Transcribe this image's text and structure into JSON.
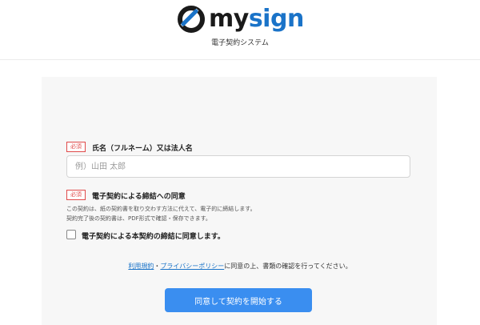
{
  "header": {
    "brand_my": "my",
    "brand_sign": "sign",
    "subtitle": "電子契約システム"
  },
  "form": {
    "required_badge": "必須",
    "name_label": "氏名（フルネーム）又は法人名",
    "name_placeholder": "例）山田 太郎",
    "name_value": "",
    "consent_label": "電子契約による締結への同意",
    "consent_desc_1": "この契約は、紙の契約書を取り交わす方法に代えて、電子的に締結します。",
    "consent_desc_2": "契約完了後の契約書は、PDF形式で確認・保存できます。",
    "checkbox_label": "電子契約による本契約の締結に同意します。",
    "checkbox_checked": false
  },
  "terms": {
    "link_terms": "利用規約",
    "separator": "・",
    "link_privacy": "プライバシーポリシー",
    "suffix": "に同意の上、書類の確認を行ってください。"
  },
  "actions": {
    "submit_label": "同意して契約を開始する"
  },
  "colors": {
    "brand_blue": "#1a73c8",
    "button_blue": "#3a8ef0",
    "required_red": "#e04a4a"
  }
}
